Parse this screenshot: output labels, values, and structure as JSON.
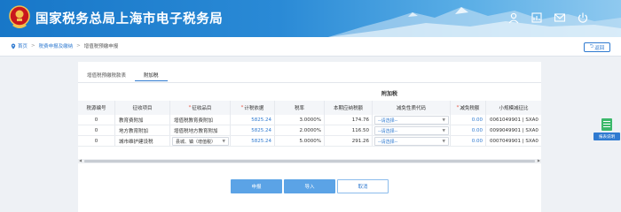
{
  "header": {
    "site_title": "国家税务总局上海市电子税务局",
    "icons": [
      "emblem-icon",
      "user-icon",
      "chart-icon",
      "mail-icon",
      "power-icon"
    ]
  },
  "breadcrumb": {
    "items": [
      "首页",
      "税费申报及缴纳",
      "增值税预缴申报"
    ],
    "back_label": "返回"
  },
  "tabs": [
    {
      "label": "增值税预缴税款表",
      "active": false
    },
    {
      "label": "附加税",
      "active": true
    }
  ],
  "table": {
    "group_header": "附加税",
    "columns": [
      "税源编号",
      "征收项目",
      "征收品目",
      "计税依据",
      "税率",
      "本期应纳税额",
      "减免性质代码",
      "减免税额",
      "小规模减征比"
    ],
    "required_columns": [
      2,
      3,
      7
    ],
    "rows": [
      {
        "source_no": "0",
        "item": "教育费附加",
        "category": "增值税教育费附加",
        "basis": "5825.24",
        "rate": "3.0000%",
        "tax": "174.76",
        "relief_code": "--请选择--",
        "relief_amount": "0.00",
        "small_scale": "0061049901 | SXA0"
      },
      {
        "source_no": "0",
        "item": "地方教育附加",
        "category": "增值税地方教育附加",
        "basis": "5825.24",
        "rate": "2.0000%",
        "tax": "116.50",
        "relief_code": "--请选择--",
        "relief_amount": "0.00",
        "small_scale": "0099049901 | SXA0"
      },
      {
        "source_no": "0",
        "item": "城市维护建设税",
        "category": "县城、镇（增值税）",
        "basis": "5825.24",
        "rate": "5.0000%",
        "tax": "291.26",
        "relief_code": "--请选择--",
        "relief_amount": "0.00",
        "small_scale": "0007049901 | SXA0"
      }
    ]
  },
  "actions": {
    "save_label": "申报",
    "import_label": "导入",
    "cancel_label": "取消"
  },
  "float_help": {
    "label": "报表说明"
  },
  "colors": {
    "header_blue": "#1877c8",
    "link_blue": "#2f7ad0",
    "button_blue": "#5ba3e6",
    "help_green": "#3bb86a"
  }
}
